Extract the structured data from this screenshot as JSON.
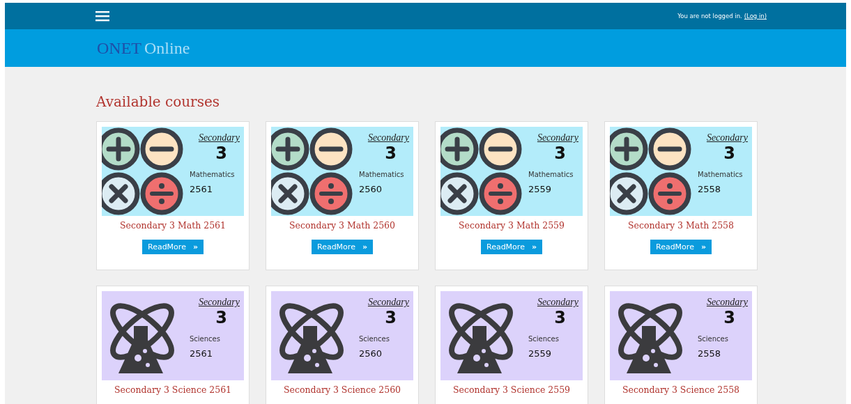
{
  "navbar": {
    "login_status": "You are not logged in.",
    "login_link": "(Log in)"
  },
  "header": {
    "logo_main": "ONET",
    "logo_sub": "Online"
  },
  "heading": "Available courses",
  "courses": [
    {
      "kind": "math",
      "image": {
        "top": "Secondary",
        "level": "3",
        "subject": "Mathematics",
        "year": "2561"
      },
      "title": "Secondary 3 Math 2561",
      "button": "ReadMore",
      "button_icon": "»"
    },
    {
      "kind": "math",
      "image": {
        "top": "Secondary",
        "level": "3",
        "subject": "Mathematics",
        "year": "2560"
      },
      "title": "Secondary 3 Math 2560",
      "button": "ReadMore",
      "button_icon": "»"
    },
    {
      "kind": "math",
      "image": {
        "top": "Secondary",
        "level": "3",
        "subject": "Mathematics",
        "year": "2559"
      },
      "title": "Secondary 3 Math 2559",
      "button": "ReadMore",
      "button_icon": "»"
    },
    {
      "kind": "math",
      "image": {
        "top": "Secondary",
        "level": "3",
        "subject": "Mathematics",
        "year": "2558"
      },
      "title": "Secondary 3 Math 2558",
      "button": "ReadMore",
      "button_icon": "»"
    },
    {
      "kind": "science",
      "image": {
        "top": "Secondary",
        "level": "3",
        "subject": "Sciences",
        "year": "2561"
      },
      "title": "Secondary 3 Science 2561"
    },
    {
      "kind": "science",
      "image": {
        "top": "Secondary",
        "level": "3",
        "subject": "Sciences",
        "year": "2560"
      },
      "title": "Secondary 3 Science 2560"
    },
    {
      "kind": "science",
      "image": {
        "top": "Secondary",
        "level": "3",
        "subject": "Sciences",
        "year": "2559"
      },
      "title": "Secondary 3 Science 2559"
    },
    {
      "kind": "science",
      "image": {
        "top": "Secondary",
        "level": "3",
        "subject": "Sciences",
        "year": "2558"
      },
      "title": "Secondary 3 Science 2558"
    }
  ]
}
